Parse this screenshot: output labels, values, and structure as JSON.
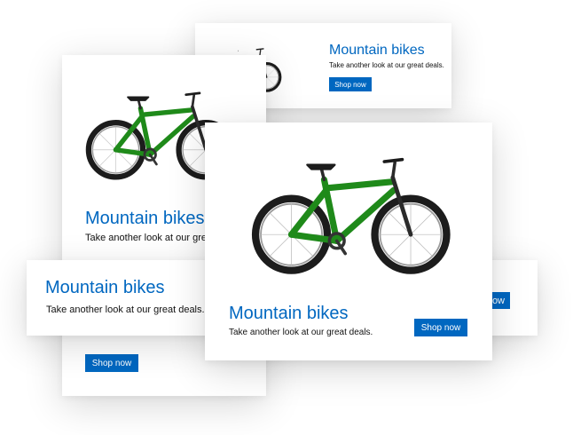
{
  "theme": {
    "accent": "#0067c0",
    "bike_color": "#1f8a1a",
    "tire_color": "#1c1c1c"
  },
  "ads": {
    "top_banner": {
      "title": "Mountain bikes",
      "tagline": "Take another look at our great deals.",
      "cta": "Shop now"
    },
    "left_tall": {
      "title": "Mountain bikes",
      "tagline": "Take another look at our great deals",
      "cta": "Shop now"
    },
    "wide_banner": {
      "title": "Mountain bikes",
      "tagline": "Take another look at our great deals.",
      "cta": "ow"
    },
    "main_featured": {
      "title": "Mountain bikes",
      "tagline": "Take another look at our great deals.",
      "cta": "Shop now"
    }
  },
  "images": {
    "bike_icon": "mountain-bike-icon"
  }
}
